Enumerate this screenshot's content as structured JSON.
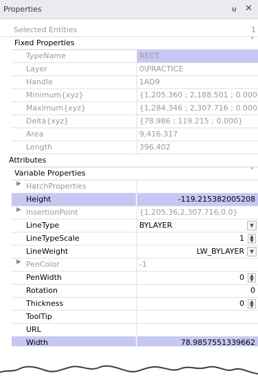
{
  "panel": {
    "title": "Properties",
    "pin_glyph": "ᵾ",
    "close_glyph": "✕"
  },
  "top_row": {
    "name": "Selected Entities",
    "value": "1"
  },
  "fixed": {
    "header": "Fixed Properties",
    "collapse_glyph": "˄",
    "rows": [
      {
        "name": "TypeName",
        "value": "RECT"
      },
      {
        "name": "Layer",
        "value": "0\\PRACTICE"
      },
      {
        "name": "Handle",
        "value": "1AD9"
      },
      {
        "name": "Minimum{xyz}",
        "value": "{1,205.360 ; 2,188.501 ; 0.000}"
      },
      {
        "name": "Maximum{xyz}",
        "value": "{1,284.346 ; 2,307.716 ; 0.000}"
      },
      {
        "name": "Delta{xyz}",
        "value": "{78.986 ; 119.215 ; 0.000}"
      },
      {
        "name": "Area",
        "value": "9,416.317"
      },
      {
        "name": "Length",
        "value": "396.402"
      }
    ]
  },
  "attributes": {
    "header": "Attributes"
  },
  "variable": {
    "header": "Variable Properties",
    "collapse_glyph": "˄",
    "rows": [
      {
        "name": "HatchProperties",
        "value": ""
      },
      {
        "name": "Height",
        "value": "-119.215382005208"
      },
      {
        "name": "InsertionPoint",
        "value": "{1,205.36,2,307.716,0.0}"
      },
      {
        "name": "LineType",
        "value": "BYLAYER"
      },
      {
        "name": "LineTypeScale",
        "value": "1"
      },
      {
        "name": "LineWeight",
        "value": "LW_BYLAYER"
      },
      {
        "name": "PenColor",
        "value": "-1"
      },
      {
        "name": "PenWidth",
        "value": "0"
      },
      {
        "name": "Rotation",
        "value": "0"
      },
      {
        "name": "Thickness",
        "value": "0"
      },
      {
        "name": "ToolTip",
        "value": ""
      },
      {
        "name": "URL",
        "value": ""
      },
      {
        "name": "Width",
        "value": "78.9857551339662"
      }
    ]
  },
  "colors": {
    "selection": "#c7c7f4",
    "titlebar": "#e9ebee",
    "readonly_text": "#9a9a9a"
  },
  "icons": {
    "expand": "chevron-right-icon",
    "collapse": "chevron-up-icon",
    "dropdown": "chevron-down-icon",
    "spinner": "spinner-icon"
  }
}
